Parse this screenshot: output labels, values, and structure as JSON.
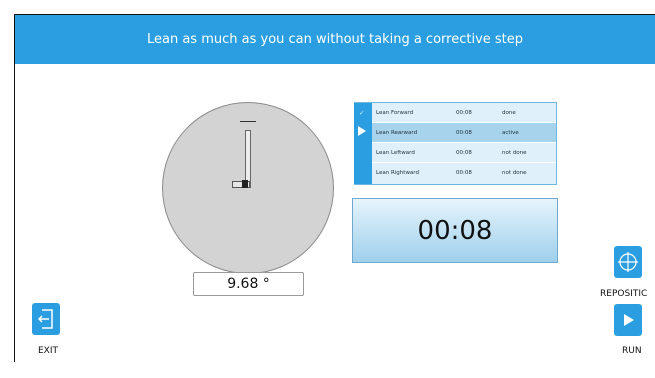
{
  "header": {
    "instruction": "Lean as much as you can without taking a corrective step"
  },
  "angle": {
    "value_text": "9.68 °"
  },
  "steps": [
    {
      "name": "Lean Forward",
      "time": "00:08",
      "status": "done"
    },
    {
      "name": "Lean Rearward",
      "time": "00:08",
      "status": "active"
    },
    {
      "name": "Lean Leftward",
      "time": "00:08",
      "status": "not done"
    },
    {
      "name": "Lean Rightward",
      "time": "00:08",
      "status": "not done"
    }
  ],
  "timer": {
    "value": "00:08"
  },
  "buttons": {
    "exit_label": "EXIT",
    "reposition_label": "REPOSITIC",
    "run_label": "RUN"
  },
  "icons": {
    "exit": "exit-door-icon",
    "reposition": "crosshair-icon",
    "run": "play-icon",
    "active_step": "play-marker-icon",
    "done_step": "check-icon"
  },
  "colors": {
    "accent": "#2a9ee0",
    "active_row": "#a8d3ec",
    "dial": "#d3d3d3"
  }
}
